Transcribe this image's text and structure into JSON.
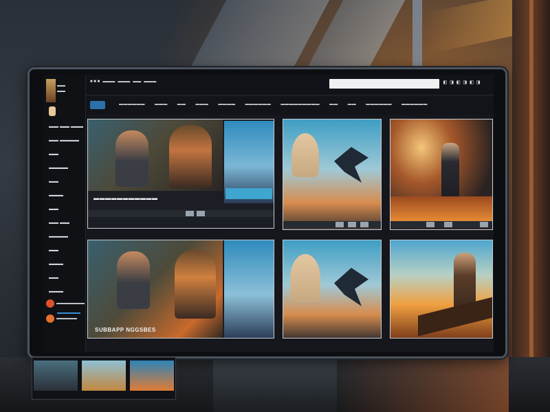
{
  "header": {
    "brand": [
      "■ ■ ■",
      "▬▬▬",
      "▬▬▬",
      "▬▬",
      "▬▬▬"
    ],
    "search_value": "",
    "icons_text": "◧ ◨ ◧ ◨ ◧ ◨"
  },
  "nav": {
    "items": [
      "▬▬▬▬▬▬",
      "▬▬▬",
      "▬▬",
      "▬▬▬",
      "▬▬▬▬",
      "▬▬▬▬▬▬",
      "▬▬▬▬▬▬▬▬▬",
      "▬▬",
      "▬▬",
      "▬▬▬▬▬▬",
      "▬▬▬▬▬▬"
    ]
  },
  "sidebar": {
    "logo_text": "▬▬\n▬▬",
    "items": [
      "▬▬ ▬▬ ▬▬▬",
      "▬▬ ▬▬▬▬",
      "▬▬",
      "▬▬▬▬",
      "▬▬",
      "▬▬▬",
      "▬▬",
      "▬▬ ▬▬",
      "▬▬▬▬",
      "▬▬",
      "▬▬▬",
      "▬▬",
      "▬▬▬",
      "▬▬▬"
    ],
    "footer": [
      {
        "label": "▬▬▬▬▬▬▬",
        "color": "#e0502a"
      },
      {
        "label": "▬▬▬▬▬",
        "color": "#e6702c"
      }
    ]
  },
  "cards": {
    "hero_top_caption": "▬▬▬▬▬▬▬▬▬▬▬",
    "hero_bottom_caption": "SUBBAPP NGGSBES"
  },
  "colors": {
    "accent": "#2d6fa8",
    "sky": "#3e9ec4",
    "fire": "#e57a2a"
  }
}
